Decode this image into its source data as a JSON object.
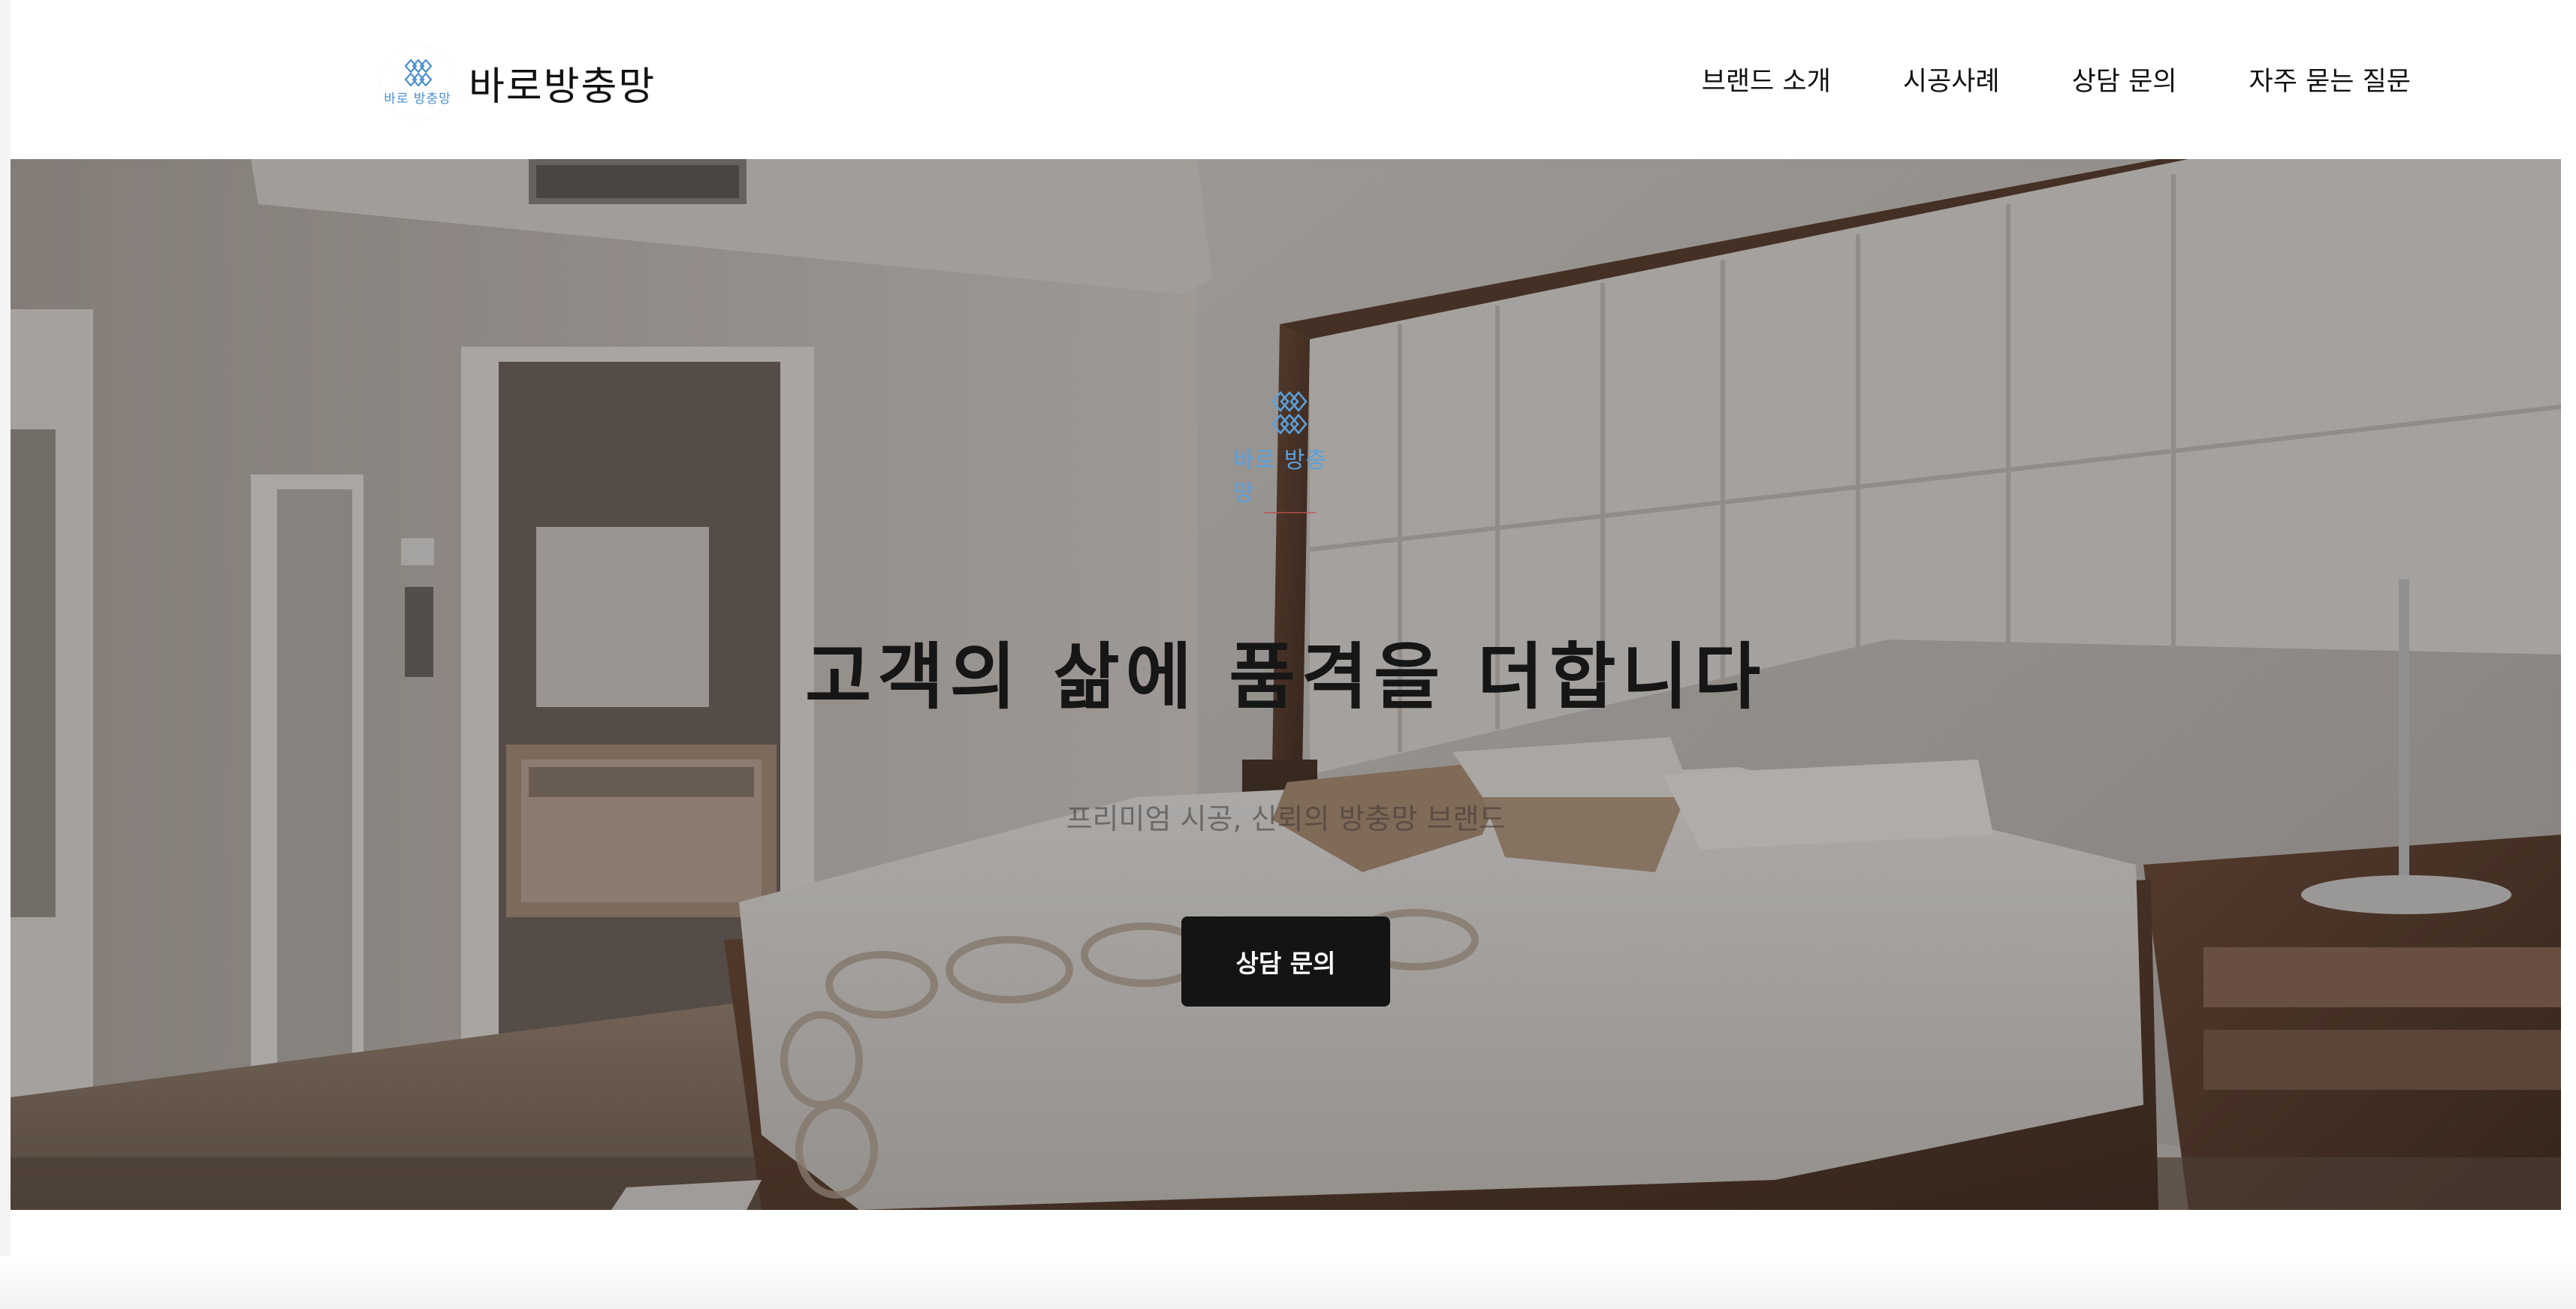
{
  "header": {
    "brand_name": "바로방충망",
    "logo_text": "바로 방충망",
    "nav": [
      {
        "label": "브랜드 소개"
      },
      {
        "label": "시공사례"
      },
      {
        "label": "상담 문의"
      },
      {
        "label": "자주 묻는 질문"
      }
    ]
  },
  "hero": {
    "logo_text": "바로 방충망",
    "title": "고객의 삶에 품격을 더합니다",
    "subtitle": "프리미엄 시공, 신뢰의 방충망 브랜드",
    "cta_label": "상담 문의"
  },
  "colors": {
    "accent": "#141414",
    "logo_blue": "#5aa0dc",
    "logo_red": "#c0504d"
  },
  "icons": {
    "brand_logo": "diamond-mesh-logo-icon",
    "hero_logo": "diamond-mesh-logo-icon"
  }
}
